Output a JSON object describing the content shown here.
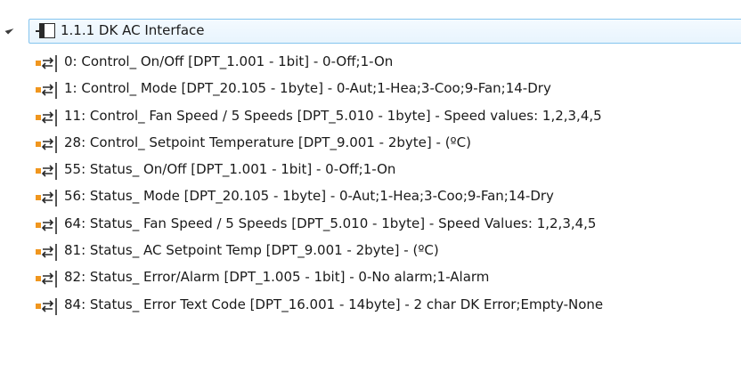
{
  "device": {
    "label": "1.1.1  DK AC Interface",
    "expander_icon": "triangle-expanded-icon",
    "icon": "knx-device-icon"
  },
  "objects_icon": "communication-object-icon",
  "colors": {
    "object_icon_orange": "#f0961e",
    "selection_border": "#84c4ee"
  },
  "objects": [
    {
      "label": "0: Control_ On/Off [DPT_1.001 - 1bit] - 0-Off;1-On"
    },
    {
      "label": "1: Control_ Mode [DPT_20.105 - 1byte] - 0-Aut;1-Hea;3-Coo;9-Fan;14-Dry"
    },
    {
      "label": "11: Control_ Fan Speed / 5 Speeds [DPT_5.010 - 1byte]  - Speed values: 1,2,3,4,5"
    },
    {
      "label": "28: Control_ Setpoint Temperature [DPT_9.001 - 2byte] - (ºC)"
    },
    {
      "label": "55: Status_ On/Off [DPT_1.001 - 1bit] - 0-Off;1-On"
    },
    {
      "label": "56: Status_ Mode [DPT_20.105 - 1byte] - 0-Aut;1-Hea;3-Coo;9-Fan;14-Dry"
    },
    {
      "label": "64: Status_ Fan Speed / 5 Speeds [DPT_5.010 - 1byte] - Speed Values: 1,2,3,4,5"
    },
    {
      "label": "81: Status_ AC Setpoint Temp [DPT_9.001 - 2byte] - (ºC)"
    },
    {
      "label": "82: Status_ Error/Alarm [DPT_1.005 - 1bit] - 0-No alarm;1-Alarm"
    },
    {
      "label": "84: Status_ Error Text Code [DPT_16.001 - 14byte] - 2 char DK Error;Empty-None"
    }
  ]
}
